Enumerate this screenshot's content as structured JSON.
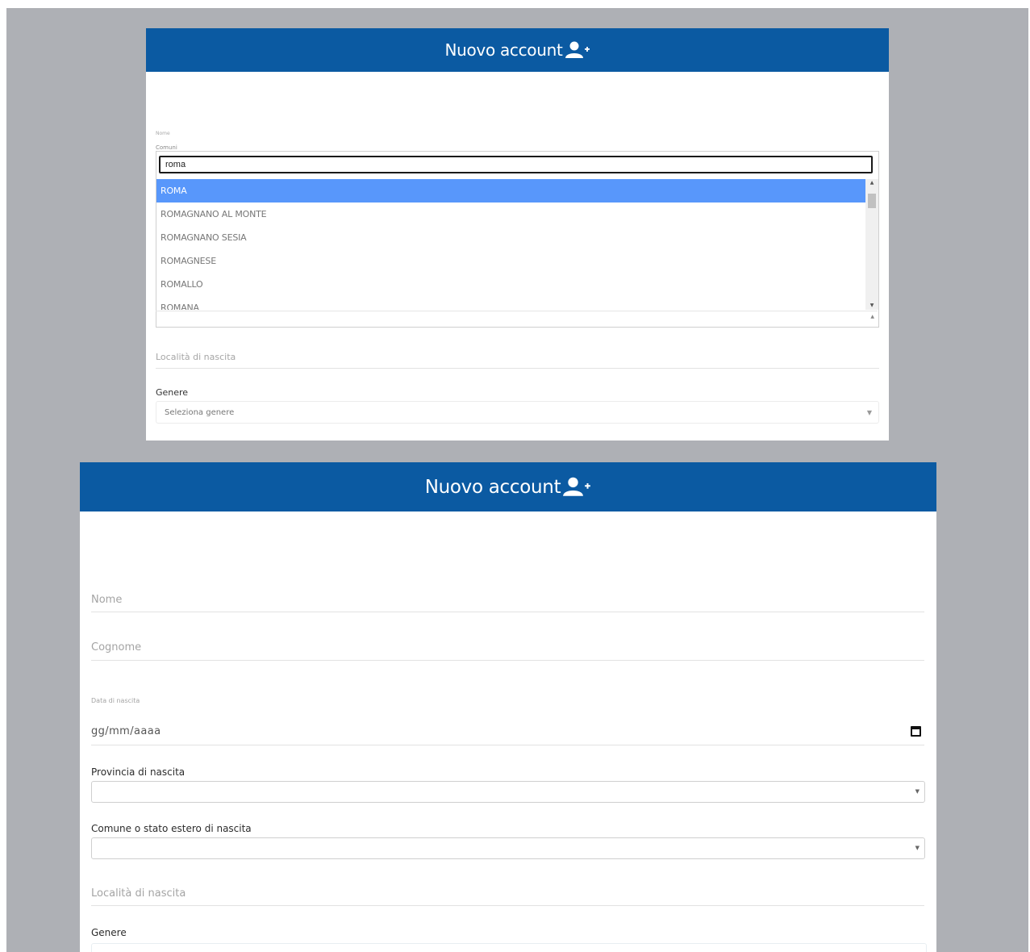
{
  "header": {
    "title": "Nuovo account"
  },
  "top_panel": {
    "tiny_label": "Nome",
    "tiny_label2": "Comuni",
    "dropdown": {
      "search_value": "roma",
      "options": [
        "ROMA",
        "ROMAGNANO AL MONTE",
        "ROMAGNANO SESIA",
        "ROMAGNESE",
        "ROMALLO",
        "ROMANA"
      ],
      "selected_index": 0
    },
    "localita_placeholder": "Località di nascita",
    "genere_label": "Genere",
    "genere_select": "Seleziona genere"
  },
  "bottom_panel": {
    "nome_placeholder": "Nome",
    "cognome_placeholder": "Cognome",
    "data_label": "Data di nascita",
    "data_placeholder": "gg/mm/aaaa",
    "provincia_label": "Provincia di nascita",
    "comune_label": "Comune o stato estero di nascita",
    "localita_placeholder": "Località di nascita",
    "genere_label": "Genere"
  },
  "colors": {
    "header_bg": "#0b5aa2",
    "selected_option": "#5897fb",
    "backdrop": "#aeb0b5"
  },
  "icons": {
    "header_icon": "user-plus-icon",
    "calendar_icon": "calendar-icon"
  }
}
